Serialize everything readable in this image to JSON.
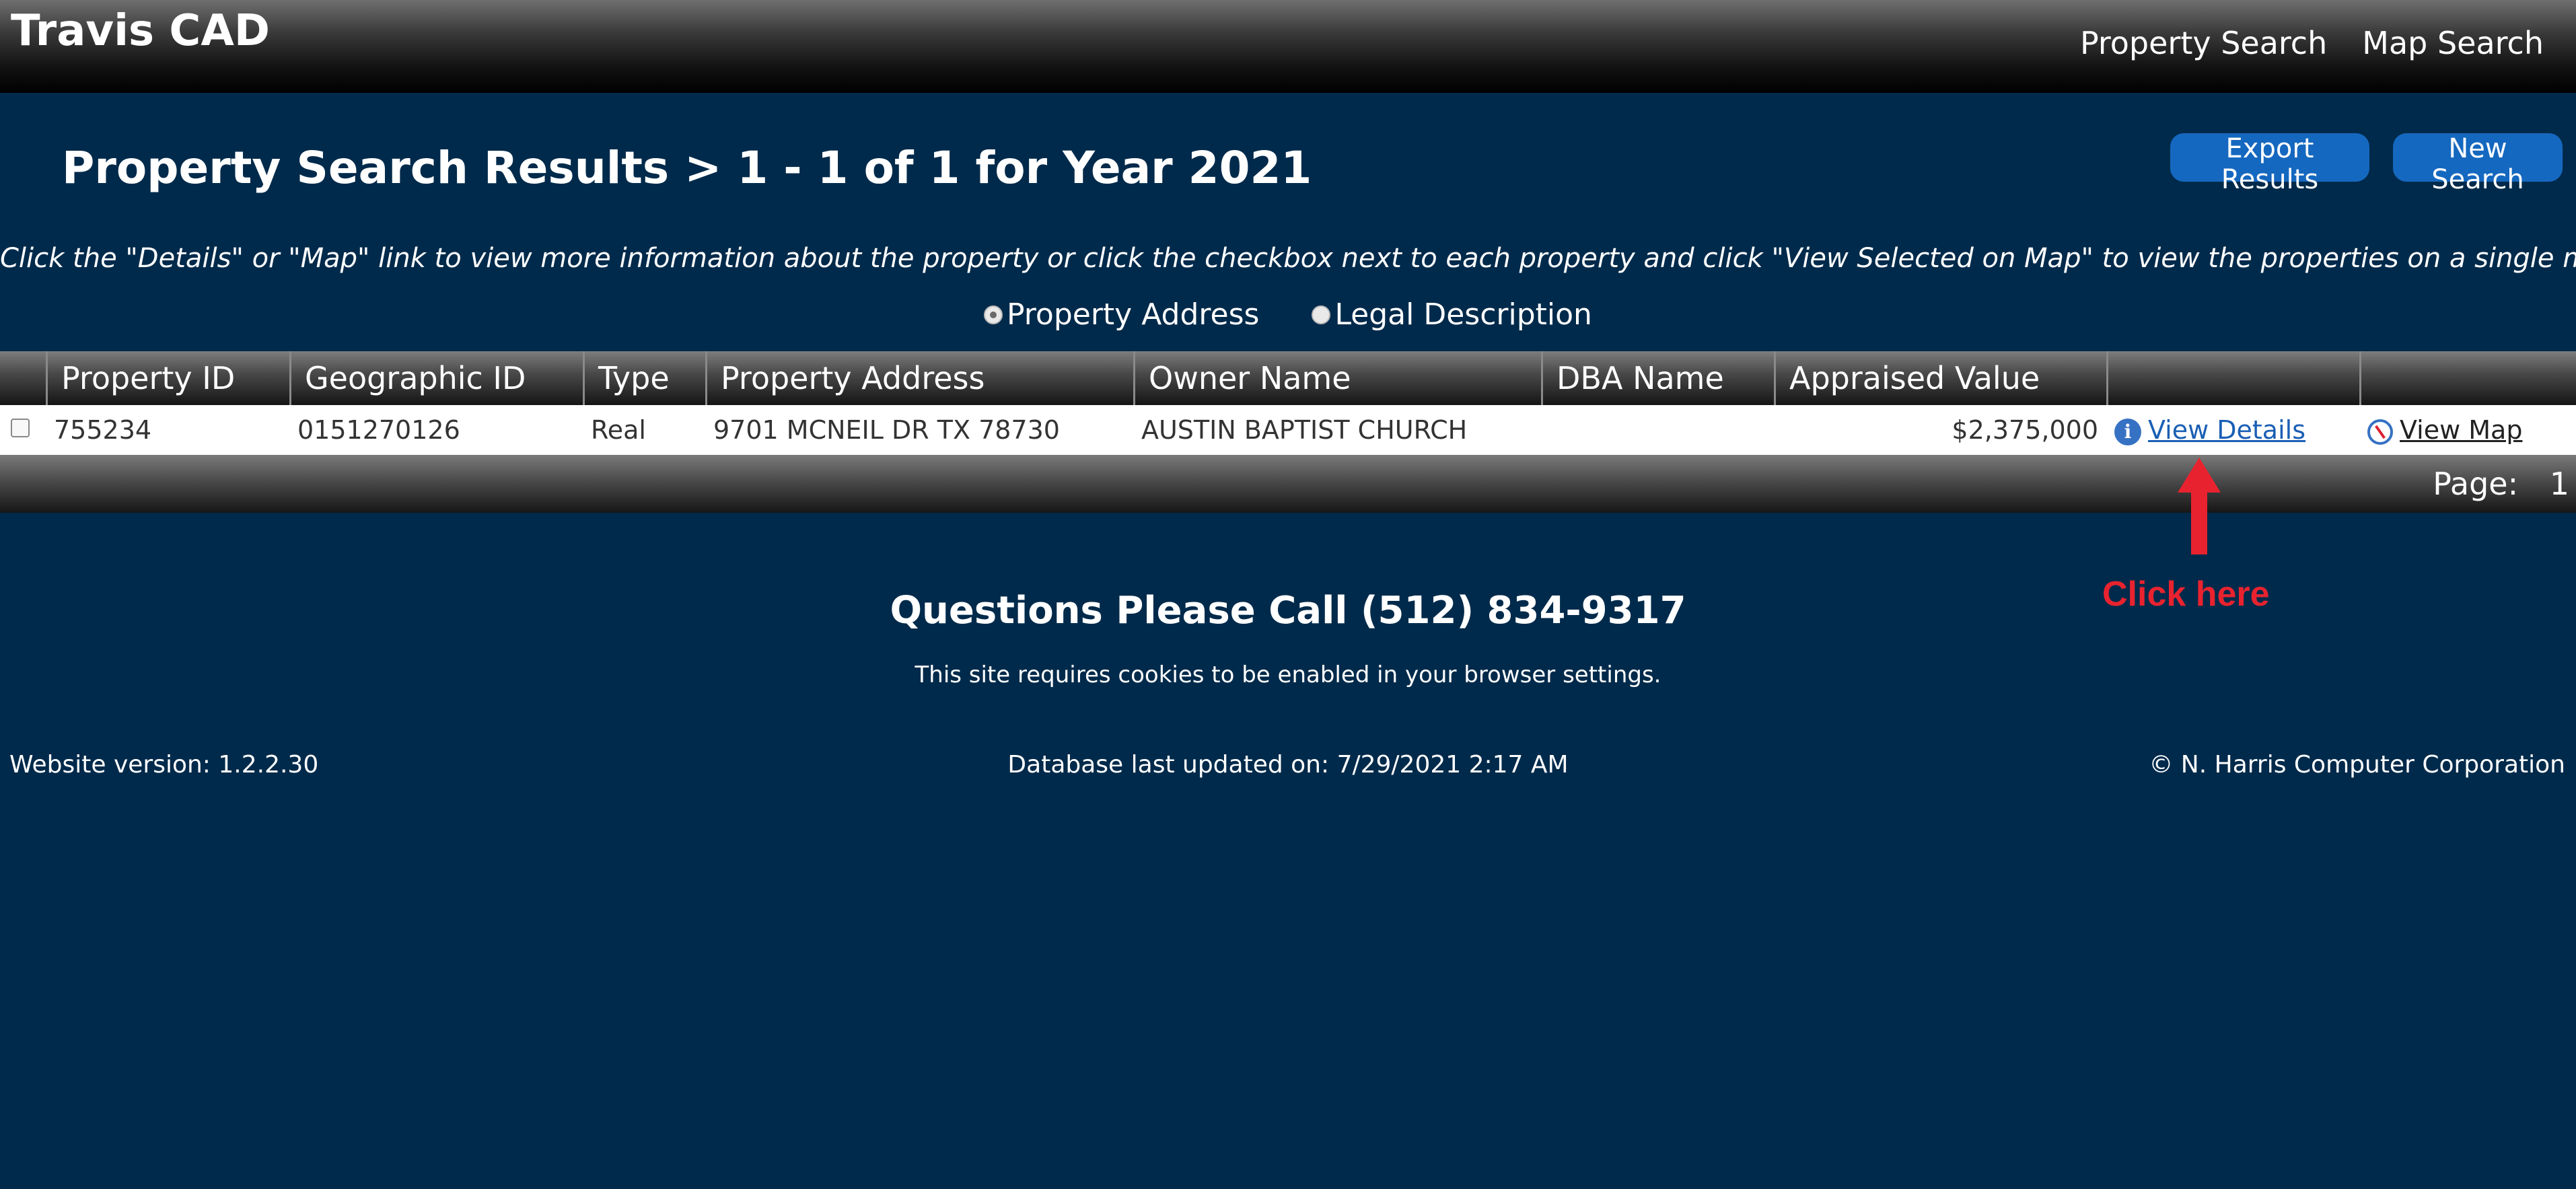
{
  "header": {
    "brand": "Travis CAD",
    "nav": [
      "Property Search",
      "Map Search"
    ]
  },
  "page": {
    "title": "Property Search Results > 1 - 1 of 1 for Year 2021",
    "buttons": {
      "export": "Export Results",
      "new_search": "New Search"
    },
    "instructions": "Click the \"Details\" or \"Map\" link to view more information about the property or click the checkbox next to each property and click \"View Selected on Map\" to view the properties on a single map.",
    "search_mode": {
      "options": [
        "Property Address",
        "Legal Description"
      ],
      "selected": "Property Address"
    }
  },
  "table": {
    "columns": [
      "",
      "Property ID",
      "Geographic ID",
      "Type",
      "Property Address",
      "Owner Name",
      "DBA Name",
      "Appraised Value",
      "",
      ""
    ],
    "rows": [
      {
        "property_id": "755234",
        "geographic_id": "0151270126",
        "type": "Real",
        "address": "9701 MCNEIL DR TX 78730",
        "owner": "AUSTIN BAPTIST CHURCH",
        "dba": "",
        "value": "$2,375,000",
        "details_link": "View Details",
        "map_link": "View Map"
      }
    ],
    "pager": {
      "label": "Page:",
      "current": "1"
    }
  },
  "annotation": {
    "text": "Click here",
    "color": "#e8232f",
    "icon": "arrow-up-icon"
  },
  "footer": {
    "phone": "Questions Please Call (512) 834-9317",
    "cookies": "This site requires cookies to be enabled in your browser settings.",
    "version": "Website version: 1.2.2.30",
    "db_updated": "Database last updated on: 7/29/2021 2:17 AM",
    "copyright": "© N. Harris Computer Corporation"
  },
  "colors": {
    "background": "#002a4b",
    "button": "#1568bf",
    "link": "#1a5fb4",
    "callout": "#e8232f"
  }
}
